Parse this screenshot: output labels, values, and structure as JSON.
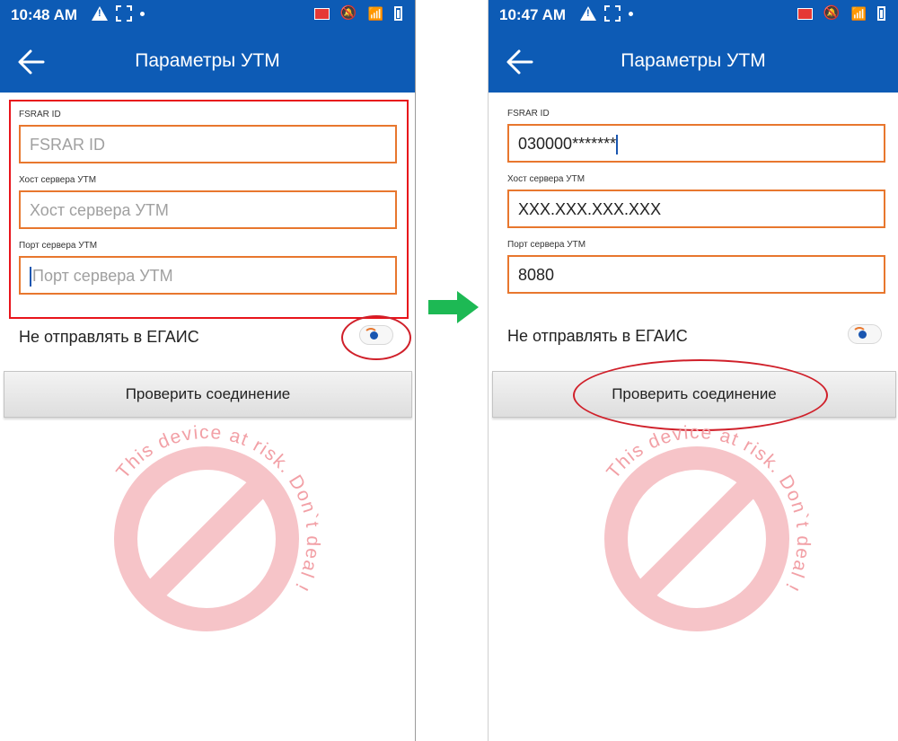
{
  "screens": [
    {
      "status": {
        "time": "10:48 AM"
      },
      "title": "Параметры УТМ",
      "fields": [
        {
          "label": "FSRAR ID",
          "value": "",
          "placeholder": "FSRAR ID"
        },
        {
          "label": "Хост сервера УТМ",
          "value": "",
          "placeholder": "Хост сервера УТМ"
        },
        {
          "label": "Порт сервера УТМ",
          "value": "",
          "placeholder": "Порт сервера УТМ"
        }
      ],
      "toggle_label": "Не отправлять в ЕГАИС",
      "button_label": "Проверить соединение"
    },
    {
      "status": {
        "time": "10:47 AM"
      },
      "title": "Параметры УТМ",
      "fields": [
        {
          "label": "FSRAR ID",
          "value": "030000*******",
          "placeholder": "FSRAR ID"
        },
        {
          "label": "Хост сервера УТМ",
          "value": "XXX.XXX.XXX.XXX",
          "placeholder": "Хост сервера УТМ"
        },
        {
          "label": "Порт сервера УТМ",
          "value": "8080",
          "placeholder": "Порт сервера УТМ"
        }
      ],
      "toggle_label": "Не отправлять в ЕГАИС",
      "button_label": "Проверить соединение"
    }
  ],
  "watermark": {
    "text": "This device at risk. Don`t deal !",
    "color": "#f2a0a6"
  },
  "colors": {
    "appbar": "#0d5bb5",
    "field_border": "#e8772e",
    "highlight": "#e8141b",
    "arrow": "#1db954"
  }
}
